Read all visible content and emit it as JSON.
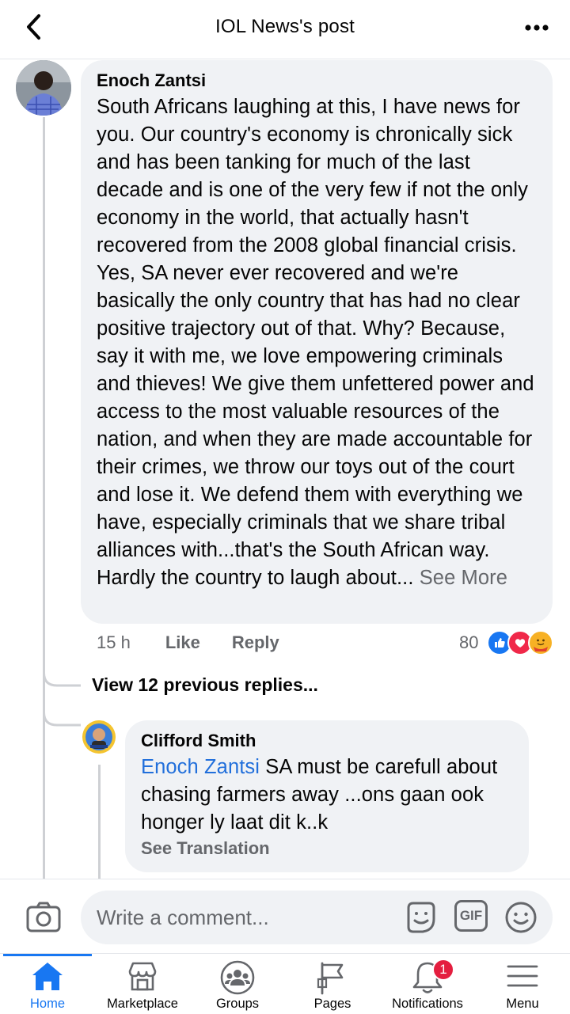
{
  "header": {
    "title": "IOL News's post"
  },
  "comment": {
    "author": "Enoch Zantsi",
    "text": "South Africans laughing at this, I have news for you. Our country's economy is chronically sick and has been tanking for much of the last decade and is one of the very few if not the only economy in the world, that actually hasn't recovered from the 2008 global financial crisis. Yes, SA never ever recovered and we're basically the only country that has had no clear positive trajectory out of that. Why? Because, say it with me, we love empowering criminals and thieves! We give them unfettered power and access to the most valuable resources of the nation, and when they are made accountable for their crimes, we throw our toys out of the court and lose it. We defend them with everything we have, especially criminals that we share tribal alliances with...that's the South African way. Hardly the country to laugh about...",
    "see_more": "See More",
    "time": "15 h",
    "like_label": "Like",
    "reply_label": "Reply",
    "reaction_count": "80",
    "reactions": [
      "like",
      "love",
      "care"
    ]
  },
  "view_previous": "View 12 previous replies...",
  "reply": {
    "author": "Clifford Smith",
    "mention": "Enoch Zantsi",
    "text": " SA must be carefull about chasing farmers away ...ons gaan ook honger ly laat dit k..k",
    "see_translation": "See Translation"
  },
  "composer": {
    "placeholder": "Write a comment...",
    "gif_label": "GIF"
  },
  "nav": {
    "items": [
      {
        "label": "Home",
        "icon": "home-icon",
        "active": true
      },
      {
        "label": "Marketplace",
        "icon": "marketplace-icon"
      },
      {
        "label": "Groups",
        "icon": "groups-icon"
      },
      {
        "label": "Pages",
        "icon": "pages-icon"
      },
      {
        "label": "Notifications",
        "icon": "bell-icon",
        "badge": "1"
      },
      {
        "label": "Menu",
        "icon": "menu-icon"
      }
    ]
  },
  "colors": {
    "accent": "#1877f2",
    "mention": "#216fdb",
    "badge": "#e41e3f",
    "bubble": "#f0f2f5",
    "secondary_text": "#65676b"
  }
}
